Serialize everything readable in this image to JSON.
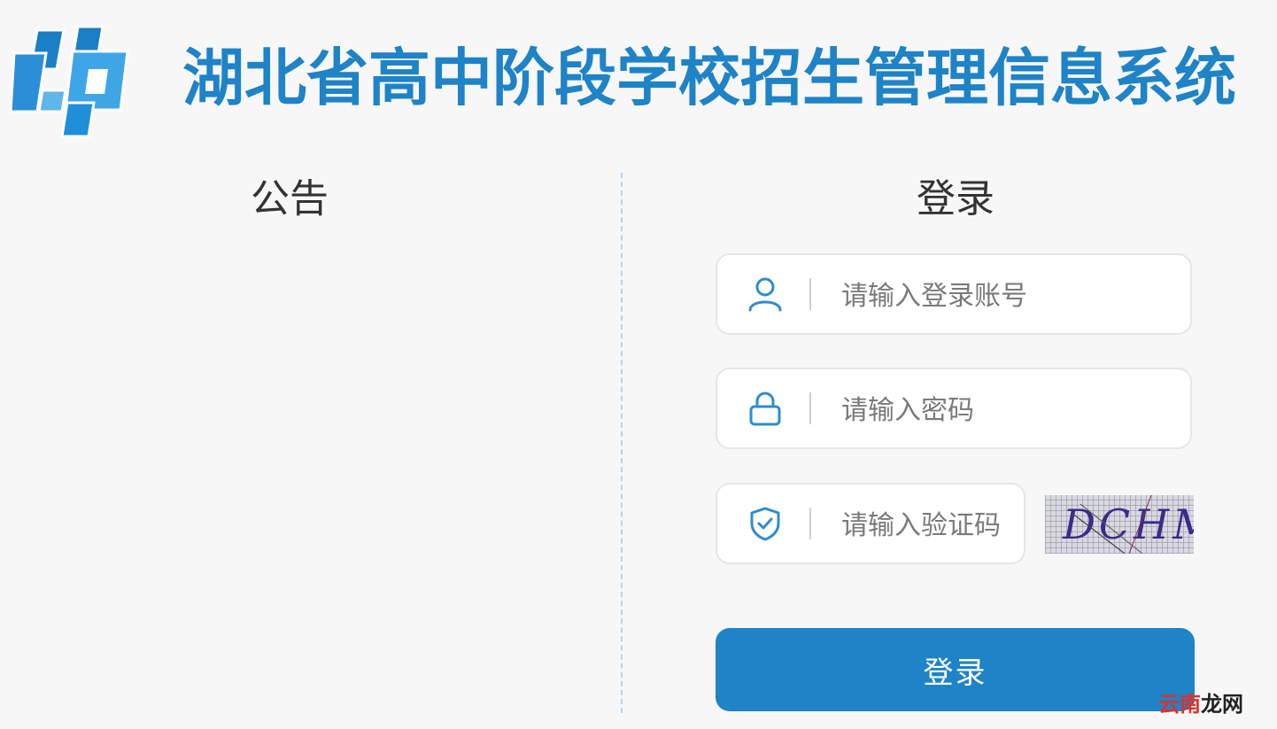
{
  "header": {
    "title": "湖北省高中阶段学校招生管理信息系统",
    "logo_icon": "cp-logo-icon"
  },
  "notice": {
    "title": "公告"
  },
  "login": {
    "title": "登录",
    "username": {
      "placeholder": "请输入登录账号",
      "icon": "user-icon"
    },
    "password": {
      "placeholder": "请输入密码",
      "icon": "lock-icon"
    },
    "captcha": {
      "placeholder": "请输入验证码",
      "icon": "shield-check-icon",
      "image_text": "DCHM"
    },
    "submit_label": "登录"
  },
  "watermark": {
    "part1": "云南",
    "part2": "龙网"
  },
  "colors": {
    "brand": "#1e83c7",
    "background": "#f7f7f7",
    "divider": "#b9d3ea"
  }
}
